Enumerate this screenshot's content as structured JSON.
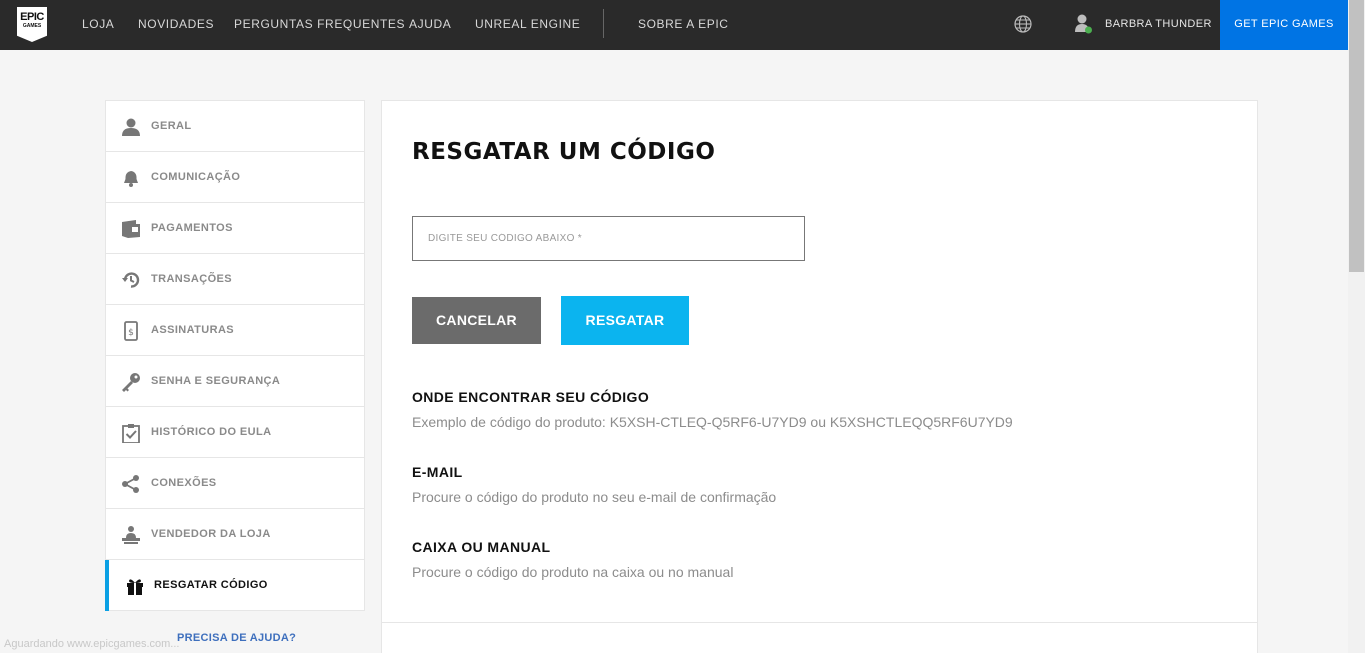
{
  "header": {
    "logo_top": "EPIC",
    "logo_bottom": "GAMES",
    "nav": [
      "LOJA",
      "NOVIDADES",
      "PERGUNTAS FREQUENTES",
      "AJUDA",
      "UNREAL ENGINE",
      "SOBRE A EPIC"
    ],
    "username": "BARBRA THUNDER",
    "get_button": "GET EPIC GAMES",
    "icons": {
      "language": "globe-icon",
      "user": "user-avatar-icon"
    }
  },
  "sidebar": {
    "items": [
      {
        "label": "GERAL",
        "icon": "person-icon"
      },
      {
        "label": "COMUNICAÇÃO",
        "icon": "bell-icon"
      },
      {
        "label": "PAGAMENTOS",
        "icon": "wallet-icon"
      },
      {
        "label": "TRANSAÇÕES",
        "icon": "history-icon"
      },
      {
        "label": "ASSINATURAS",
        "icon": "subscription-icon"
      },
      {
        "label": "SENHA E SEGURANÇA",
        "icon": "key-icon"
      },
      {
        "label": "HISTÓRICO DO EULA",
        "icon": "clipboard-check-icon"
      },
      {
        "label": "CONEXÕES",
        "icon": "share-icon"
      },
      {
        "label": "VENDEDOR DA LOJA",
        "icon": "seller-icon"
      },
      {
        "label": "RESGATAR CÓDIGO",
        "icon": "gift-icon"
      }
    ],
    "active_index": 9,
    "help_link": "PRECISA DE AJUDA?"
  },
  "main": {
    "title": "RESGATAR UM CÓDIGO",
    "code_input": {
      "placeholder": "DIGITE SEU CÓDIGO ABAIXO *",
      "value": ""
    },
    "cancel_label": "CANCELAR",
    "redeem_label": "RESGATAR",
    "sections": [
      {
        "heading": "ONDE ENCONTRAR SEU CÓDIGO",
        "text": "Exemplo de código do produto: K5XSH-CTLEQ-Q5RF6-U7YD9 ou K5XSHCTLEQQ5RF6U7YD9"
      },
      {
        "heading": "E-MAIL",
        "text": "Procure o código do produto no seu e-mail de confirmação"
      },
      {
        "heading": "CAIXA OU MANUAL",
        "text": "Procure o código do produto na caixa ou no manual"
      }
    ]
  },
  "status_bar": "Aguardando www.epicgames.com...",
  "colors": {
    "nav_bg": "#2a2a2a",
    "get_button": "#0074e4",
    "redeem": "#0bb4ef",
    "cancel": "#6b6b6b",
    "active_accent": "#0aa0e4"
  }
}
